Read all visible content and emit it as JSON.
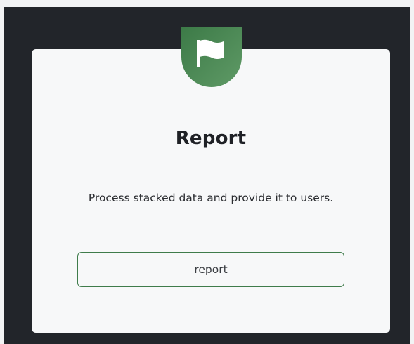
{
  "card": {
    "icon": "flag-icon",
    "title": "Report",
    "description": "Process stacked data and provide it to users.",
    "button_label": "report"
  },
  "colors": {
    "background_dark": "#22252a",
    "card": "#f7f8f9",
    "accent_green": "#3f7c4b"
  }
}
